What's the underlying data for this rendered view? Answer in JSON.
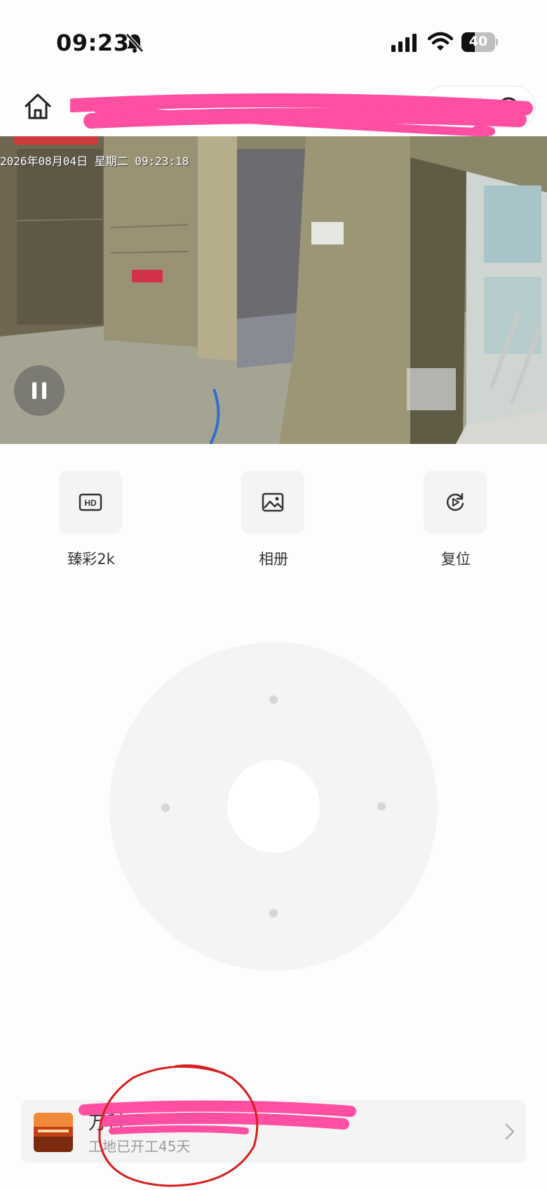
{
  "status_bar": {
    "time": "09:23",
    "battery_level": "40",
    "icons": [
      "bell-off-icon",
      "cellular-signal-icon",
      "wifi-icon",
      "battery-icon"
    ]
  },
  "nav": {
    "title": "",
    "icons": [
      "home-icon",
      "more-icon",
      "close-icon"
    ]
  },
  "video": {
    "osd_timestamp": "2026年08月04日 星期二 09:23:18",
    "state": "playing"
  },
  "controls": [
    {
      "label": "臻彩2k",
      "icon": "hd-icon"
    },
    {
      "label": "相册",
      "icon": "image-icon"
    },
    {
      "label": "复位",
      "icon": "reset-play-icon"
    }
  ],
  "ptz": {
    "directions": [
      "up",
      "down",
      "left",
      "right"
    ]
  },
  "project_card": {
    "title": "万科",
    "subtitle": "工地已开工45天",
    "icon": "chevron-right-icon"
  },
  "colors": {
    "redaction": "#ff4fa3",
    "annotation_circle": "#d81e1e",
    "panel_gray": "#f4f4f4"
  }
}
